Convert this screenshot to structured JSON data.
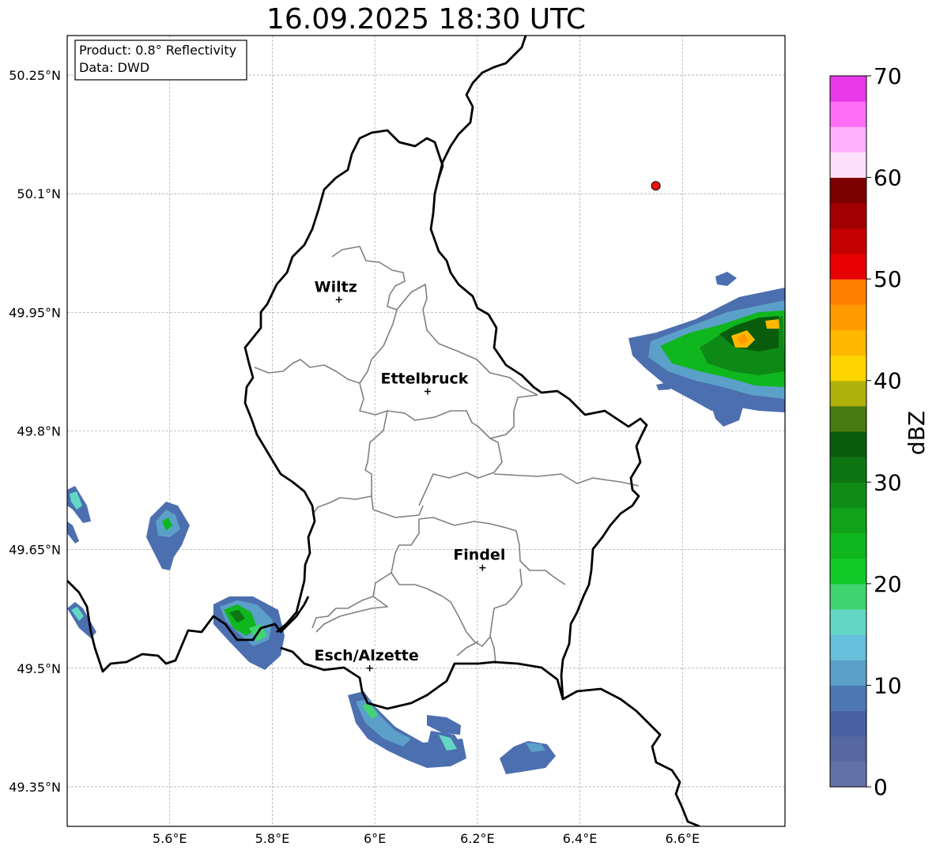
{
  "title": "16.09.2025 18:30 UTC",
  "info_box": {
    "product": "Product: 0.8° Reflectivity",
    "data": "Data: DWD"
  },
  "map": {
    "lon_range": [
      5.4,
      6.8
    ],
    "lat_range": [
      49.3,
      50.3
    ],
    "grid": true,
    "lat_ticks": [
      {
        "value": 50.25,
        "label": "50.25°N"
      },
      {
        "value": 50.1,
        "label": "50.1°N"
      },
      {
        "value": 49.95,
        "label": "49.95°N"
      },
      {
        "value": 49.8,
        "label": "49.8°N"
      },
      {
        "value": 49.65,
        "label": "49.65°N"
      },
      {
        "value": 49.5,
        "label": "49.5°N"
      },
      {
        "value": 49.35,
        "label": "49.35°N"
      }
    ],
    "lon_ticks": [
      {
        "value": 5.6,
        "label": "5.6°E"
      },
      {
        "value": 5.8,
        "label": "5.8°E"
      },
      {
        "value": 6.0,
        "label": "6°E"
      },
      {
        "value": 6.2,
        "label": "6.2°E"
      },
      {
        "value": 6.4,
        "label": "6.4°E"
      },
      {
        "value": 6.6,
        "label": "6.6°E"
      }
    ],
    "cities": [
      {
        "name": "Wiltz",
        "lon": 5.93,
        "lat": 49.966
      },
      {
        "name": "Ettelbruck",
        "lon": 6.103,
        "lat": 49.85
      },
      {
        "name": "Findel",
        "lon": 6.21,
        "lat": 49.627
      },
      {
        "name": "Esch/Alzette",
        "lon": 5.99,
        "lat": 49.5
      }
    ],
    "radar_site": {
      "lon": 6.548,
      "lat": 50.11,
      "color": "#e81010"
    }
  },
  "colorbar": {
    "label": "dBZ",
    "min": 0,
    "max": 70,
    "step": 2.5,
    "ticks": [
      "0",
      "10",
      "20",
      "30",
      "40",
      "50",
      "60",
      "70"
    ],
    "colors": [
      "#6272a8",
      "#56689f",
      "#4862a1",
      "#4d78b2",
      "#5ba0c8",
      "#66bfdb",
      "#64d7c4",
      "#40d471",
      "#13c928",
      "#10b61e",
      "#11a21b",
      "#108c16",
      "#0d7612",
      "#0a5c0d",
      "#477a10",
      "#b0b10a",
      "#ffd500",
      "#ffb700",
      "#ff9b00",
      "#ff8000",
      "#e60000",
      "#c40000",
      "#a00000",
      "#7c0000",
      "#ffe0fb",
      "#ffb2fb",
      "#ff6ff6",
      "#e939e9"
    ]
  }
}
